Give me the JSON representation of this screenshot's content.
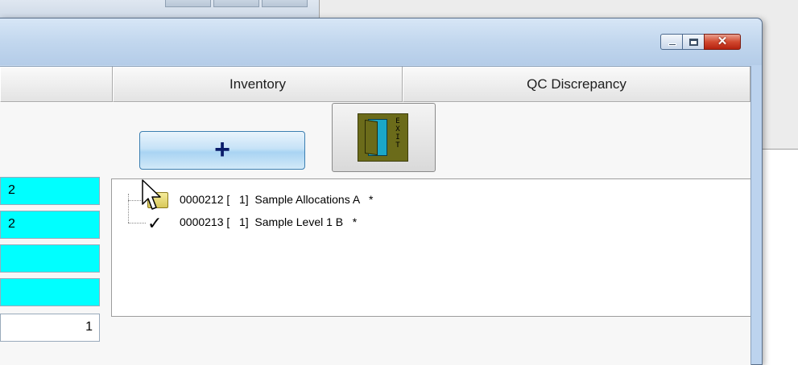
{
  "window": {
    "caption_buttons": [
      "minimize",
      "maximize",
      "close"
    ]
  },
  "tabs": [
    {
      "label": ""
    },
    {
      "label": "Inventory"
    },
    {
      "label": "QC Discrepancy"
    }
  ],
  "toolbar": {
    "add_label": "+",
    "exit_icon_letters": "EXIT"
  },
  "fields": [
    "2",
    "2",
    "",
    "",
    "1"
  ],
  "tree": {
    "items": [
      {
        "text": "0000212 [   1]  Sample Allocations A   *",
        "icon": "folder-icon"
      },
      {
        "text": "0000213 [   1]  Sample Level 1 B   *",
        "icon": "check-icon"
      }
    ]
  },
  "colors": {
    "field_highlight": "#00ffff",
    "close_button": "#c7391f",
    "add_button": "#bfe0f7"
  }
}
